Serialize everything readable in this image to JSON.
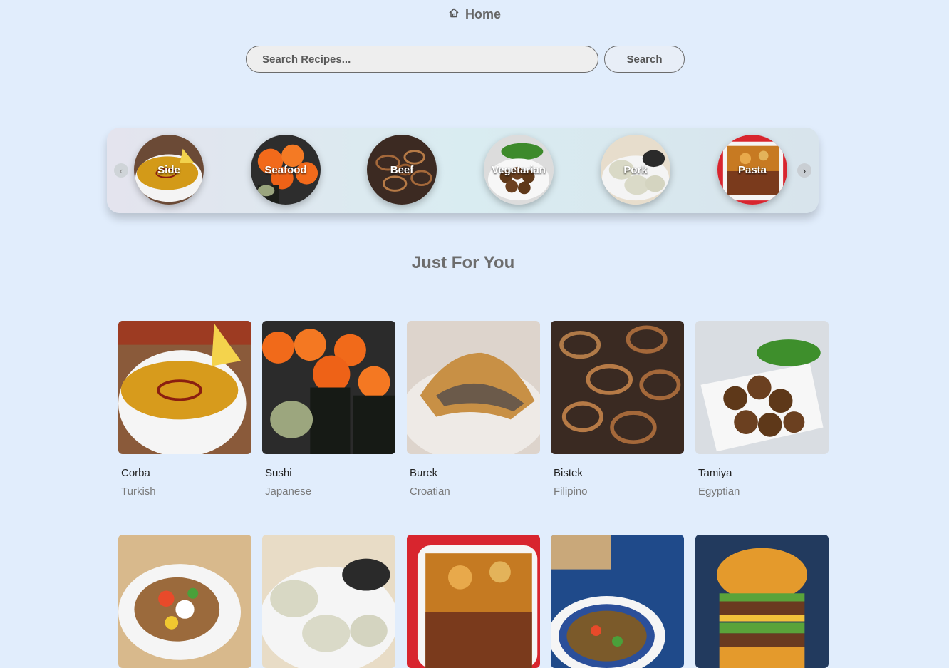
{
  "nav": {
    "home_label": "Home",
    "home_icon": "home-icon"
  },
  "search": {
    "placeholder": "Search Recipes...",
    "button_label": "Search"
  },
  "categories": [
    {
      "label": "Side"
    },
    {
      "label": "Seafood"
    },
    {
      "label": "Beef"
    },
    {
      "label": "Vegetarian"
    },
    {
      "label": "Pork"
    },
    {
      "label": "Pasta"
    }
  ],
  "section_title": "Just For You",
  "recipes": [
    {
      "name": "Corba",
      "area": "Turkish"
    },
    {
      "name": "Sushi",
      "area": "Japanese"
    },
    {
      "name": "Burek",
      "area": "Croatian"
    },
    {
      "name": "Bistek",
      "area": "Filipino"
    },
    {
      "name": "Tamiya",
      "area": "Egyptian"
    }
  ],
  "colors": {
    "background": "#e1edfc",
    "title": "#6d6d6d"
  }
}
